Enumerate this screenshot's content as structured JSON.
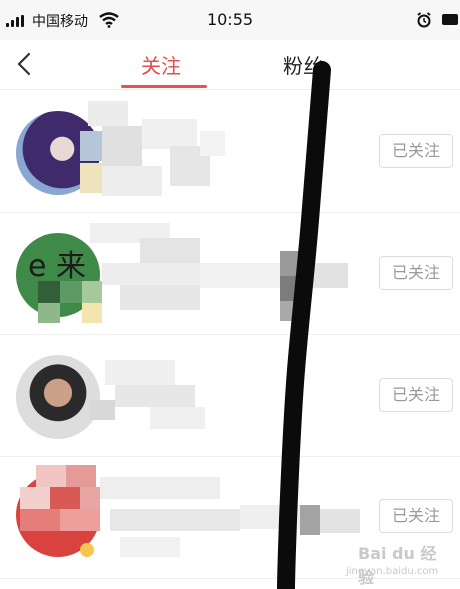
{
  "status_bar": {
    "carrier": "中国移动",
    "time": "10:55"
  },
  "nav": {
    "tabs": [
      {
        "label": "关注",
        "active": true
      },
      {
        "label": "粉丝",
        "active": false
      }
    ],
    "accent_color": "#ea5050"
  },
  "users": [
    {
      "follow_label": "已关注"
    },
    {
      "avatar_text": "e 来",
      "follow_label": "已关注"
    },
    {
      "follow_label": "已关注"
    },
    {
      "follow_label": "已关注"
    }
  ],
  "icons": [
    "signal-icon",
    "wifi-icon",
    "alarm-icon",
    "battery-icon",
    "back-arrow-icon"
  ],
  "watermark": {
    "text": "Bai du 经验",
    "sub": "jingyan.baidu.com"
  }
}
